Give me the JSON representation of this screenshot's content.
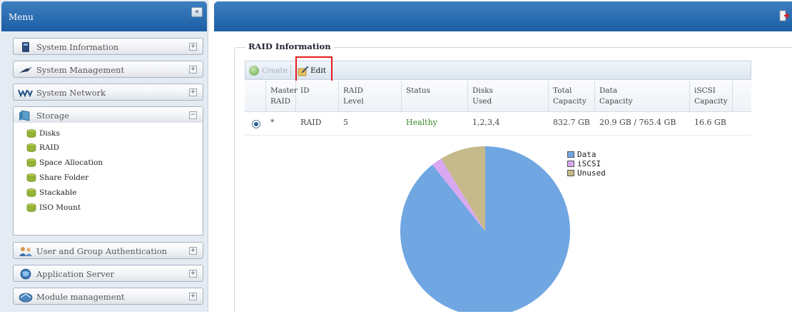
{
  "sidebar": {
    "title": "Menu",
    "collapse_label": "«",
    "items": [
      {
        "label": "System Information",
        "expand": "+"
      },
      {
        "label": "System Management",
        "expand": "+"
      },
      {
        "label": "System Network",
        "expand": "+"
      },
      {
        "label": "Storage",
        "expand": "−"
      },
      {
        "label": "User and Group Authentication",
        "expand": "+"
      },
      {
        "label": "Application Server",
        "expand": "+"
      },
      {
        "label": "Module management",
        "expand": "+"
      }
    ],
    "storage_sub": [
      "Disks",
      "RAID",
      "Space Allocation",
      "Share Folder",
      "Stackable",
      "ISO Mount"
    ]
  },
  "main": {
    "section_title": "RAID Information",
    "toolbar": {
      "create_label": "Create",
      "edit_label": "Edit"
    },
    "table": {
      "headers": [
        "Master\nRAID",
        "ID",
        "RAID\nLevel",
        "Status",
        "Disks\nUsed",
        "Total\nCapacity",
        "Data\nCapacity",
        "iSCSI\nCapacity"
      ],
      "rows": [
        {
          "master": "*",
          "id": "RAID",
          "level": "5",
          "status": "Healthy",
          "disks": "1,2,3,4",
          "total": "832.7 GB",
          "data": "20.9 GB / 765.4 GB",
          "iscsi": "16.6 GB"
        }
      ]
    }
  },
  "chart_data": {
    "type": "pie",
    "categories": [
      "Data",
      "iSCSI",
      "Unused"
    ],
    "values": [
      743.8,
      16.6,
      72.3
    ],
    "colors": [
      "#70a6e2",
      "#d9a8f0",
      "#c6b98a"
    ],
    "legend_position": "top-right"
  }
}
